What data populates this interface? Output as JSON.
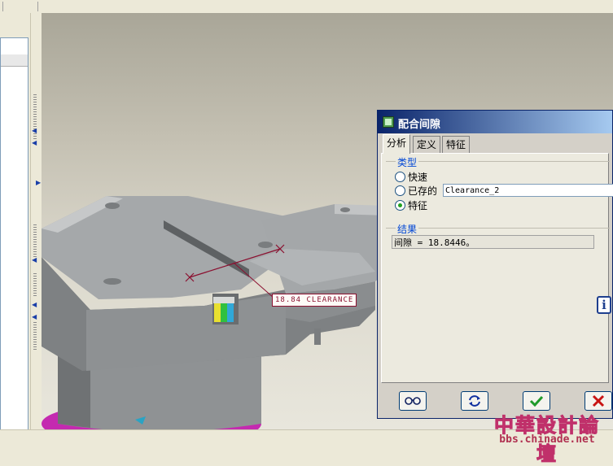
{
  "dialog": {
    "title": "配合间隙",
    "tabs": [
      {
        "label": "分析",
        "active": true
      },
      {
        "label": "定义",
        "active": false
      },
      {
        "label": "特征",
        "active": false
      }
    ],
    "type_group": {
      "label": "类型",
      "options": [
        {
          "label": "快速",
          "selected": false
        },
        {
          "label": "已存的",
          "selected": false
        },
        {
          "label": "特征",
          "selected": true
        }
      ],
      "saved_name_value": "Clearance_2"
    },
    "result_group": {
      "label": "结果",
      "text": "间隙 = 18.8446。"
    },
    "buttons": [
      {
        "icon": "glasses-icon"
      },
      {
        "icon": "repeat-icon"
      },
      {
        "icon": "checkmark-icon"
      },
      {
        "icon": "cancel-x-icon"
      }
    ]
  },
  "viewport": {
    "clearance_annotation": "18.84 CLEARANCE"
  },
  "info_button": {
    "icon": "info-icon",
    "glyph": "i"
  },
  "watermark": {
    "title": "中華設計論壇",
    "url": "bbs.chinade.net"
  },
  "colors": {
    "titlebar_start": "#0a246a",
    "titlebar_end": "#a6caf0",
    "group_label": "#0046d5",
    "confirm_green": "#1f9a2a",
    "cancel_red": "#c81414",
    "model_gray": "#a3a6a8",
    "annotation_line": "#8b1030"
  }
}
